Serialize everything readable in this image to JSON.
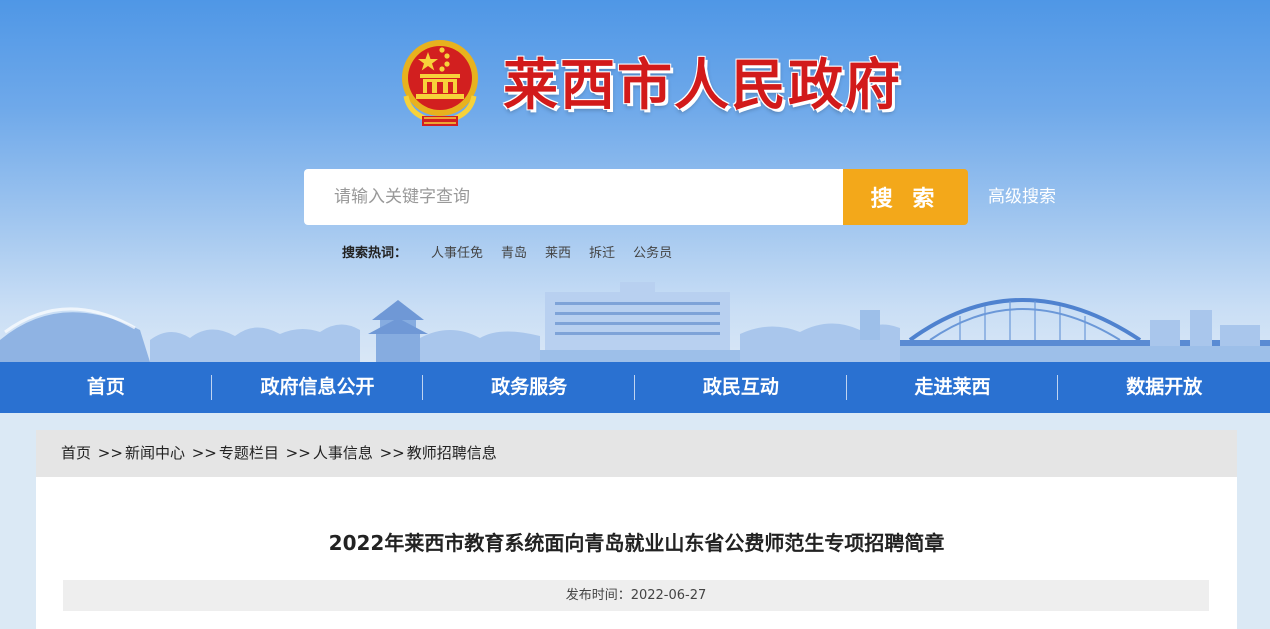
{
  "header": {
    "site_title": "莱西市人民政府",
    "search": {
      "placeholder": "请输入关键字查询",
      "button_label": "搜 索",
      "advanced_label": "高级搜索"
    },
    "hot_label": "搜索热词：",
    "hot_words": [
      "人事任免",
      "青岛",
      "莱西",
      "拆迁",
      "公务员"
    ]
  },
  "nav": {
    "items": [
      "首页",
      "政府信息公开",
      "政务服务",
      "政民互动",
      "走进莱西",
      "数据开放"
    ]
  },
  "breadcrumb": {
    "separator": ">>",
    "items": [
      "首页",
      "新闻中心",
      "专题栏目",
      "人事信息",
      "教师招聘信息"
    ]
  },
  "article": {
    "title": "2022年莱西市教育系统面向青岛就业山东省公费师范生专项招聘简章",
    "publish_label": "发布时间：",
    "publish_date": "2022-06-27"
  },
  "colors": {
    "nav_bg": "#2a71d1",
    "search_button": "#f3a81a",
    "title_red": "#d21a1a"
  }
}
